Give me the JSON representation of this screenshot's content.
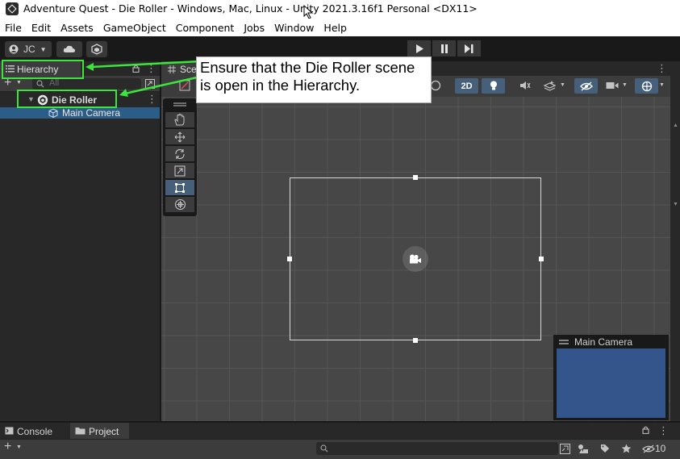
{
  "window": {
    "title": "Adventure Quest - Die Roller - Windows, Mac, Linux - Unity 2021.3.16f1 Personal <DX11>"
  },
  "menu": [
    "File",
    "Edit",
    "Assets",
    "GameObject",
    "Component",
    "Jobs",
    "Window",
    "Help"
  ],
  "toolbar": {
    "account_label": "JC"
  },
  "hierarchy": {
    "tab_label": "Hierarchy",
    "search_placeholder": "All",
    "scene_name": "Die Roller",
    "items": [
      {
        "label": "Main Camera"
      }
    ]
  },
  "scene": {
    "tab_label": "Sce",
    "mode_2d": "2D"
  },
  "camera_preview": {
    "title": "Main Camera",
    "background_color": "#34558c"
  },
  "bottom": {
    "tabs": [
      "Console",
      "Project"
    ],
    "hidden_count": "10"
  },
  "annotation": {
    "text": "Ensure that the Die Roller scene is open in the Hierarchy.",
    "highlight_color": "#3ce53c"
  }
}
